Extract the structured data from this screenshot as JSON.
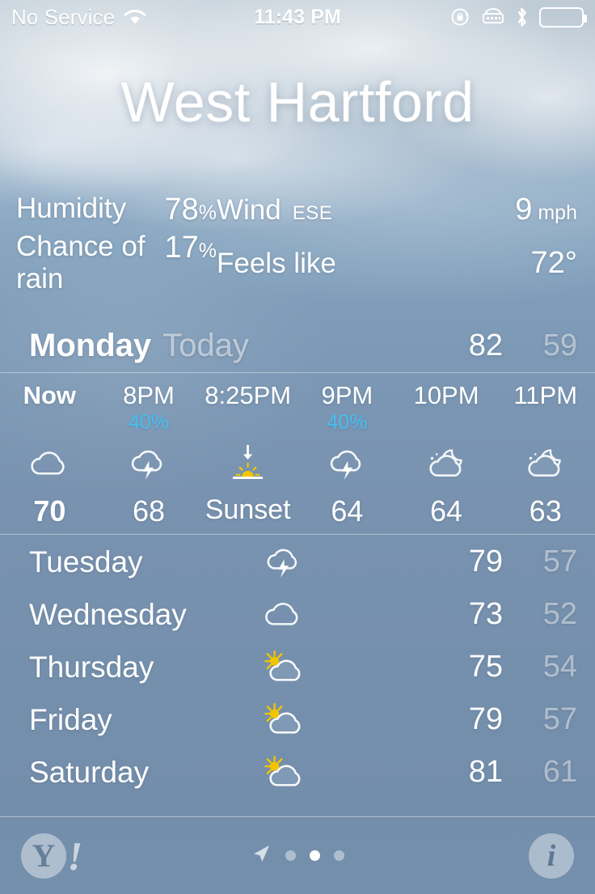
{
  "status_bar": {
    "carrier": "No Service",
    "time": "11:43 PM",
    "icons": [
      "wifi-icon",
      "rotation-lock-icon",
      "tty-icon",
      "bluetooth-icon",
      "battery-icon"
    ],
    "battery_color": "#4cd964"
  },
  "header": {
    "city": "West Hartford"
  },
  "conditions": {
    "humidity_label": "Humidity",
    "humidity_value": "78",
    "humidity_unit": "%",
    "wind_label": "Wind",
    "wind_direction": "ESE",
    "wind_speed": "9",
    "wind_unit": "mph",
    "rain_label": "Chance of rain",
    "rain_value": "17",
    "rain_unit": "%",
    "feels_label": "Feels like",
    "feels_value": "72°"
  },
  "today": {
    "day": "Monday",
    "label": "Today",
    "high": "82",
    "low": "59"
  },
  "hourly": [
    {
      "time": "Now",
      "pop": "",
      "icon": "cloud-icon",
      "temp": "70",
      "current": true
    },
    {
      "time": "8PM",
      "pop": "40%",
      "icon": "thunderstorm-icon",
      "temp": "68",
      "current": false
    },
    {
      "time": "8:25PM",
      "pop": "",
      "icon": "sunset-icon",
      "temp": "Sunset",
      "current": false
    },
    {
      "time": "9PM",
      "pop": "40%",
      "icon": "thunderstorm-icon",
      "temp": "64",
      "current": false
    },
    {
      "time": "10PM",
      "pop": "",
      "icon": "partly-cloudy-night-icon",
      "temp": "64",
      "current": false
    },
    {
      "time": "11PM",
      "pop": "",
      "icon": "partly-cloudy-night-icon",
      "temp": "63",
      "current": false
    }
  ],
  "daily": [
    {
      "name": "Tuesday",
      "icon": "thunderstorm-icon",
      "high": "79",
      "low": "57"
    },
    {
      "name": "Wednesday",
      "icon": "cloud-icon",
      "high": "73",
      "low": "52"
    },
    {
      "name": "Thursday",
      "icon": "partly-cloudy-day-icon",
      "high": "75",
      "low": "54"
    },
    {
      "name": "Friday",
      "icon": "partly-cloudy-day-icon",
      "high": "79",
      "low": "57"
    },
    {
      "name": "Saturday",
      "icon": "partly-cloudy-day-icon",
      "high": "81",
      "low": "61"
    }
  ],
  "bottom_bar": {
    "brand": "Y",
    "brand_bang": "!",
    "location_icon": "location-arrow-icon",
    "page_count": 3,
    "page_active_index": 1,
    "info_label": "i"
  },
  "colors": {
    "pop_blue": "#44c0f0",
    "sun_yellow": "#f2c400",
    "battery_green": "#4cd964"
  }
}
